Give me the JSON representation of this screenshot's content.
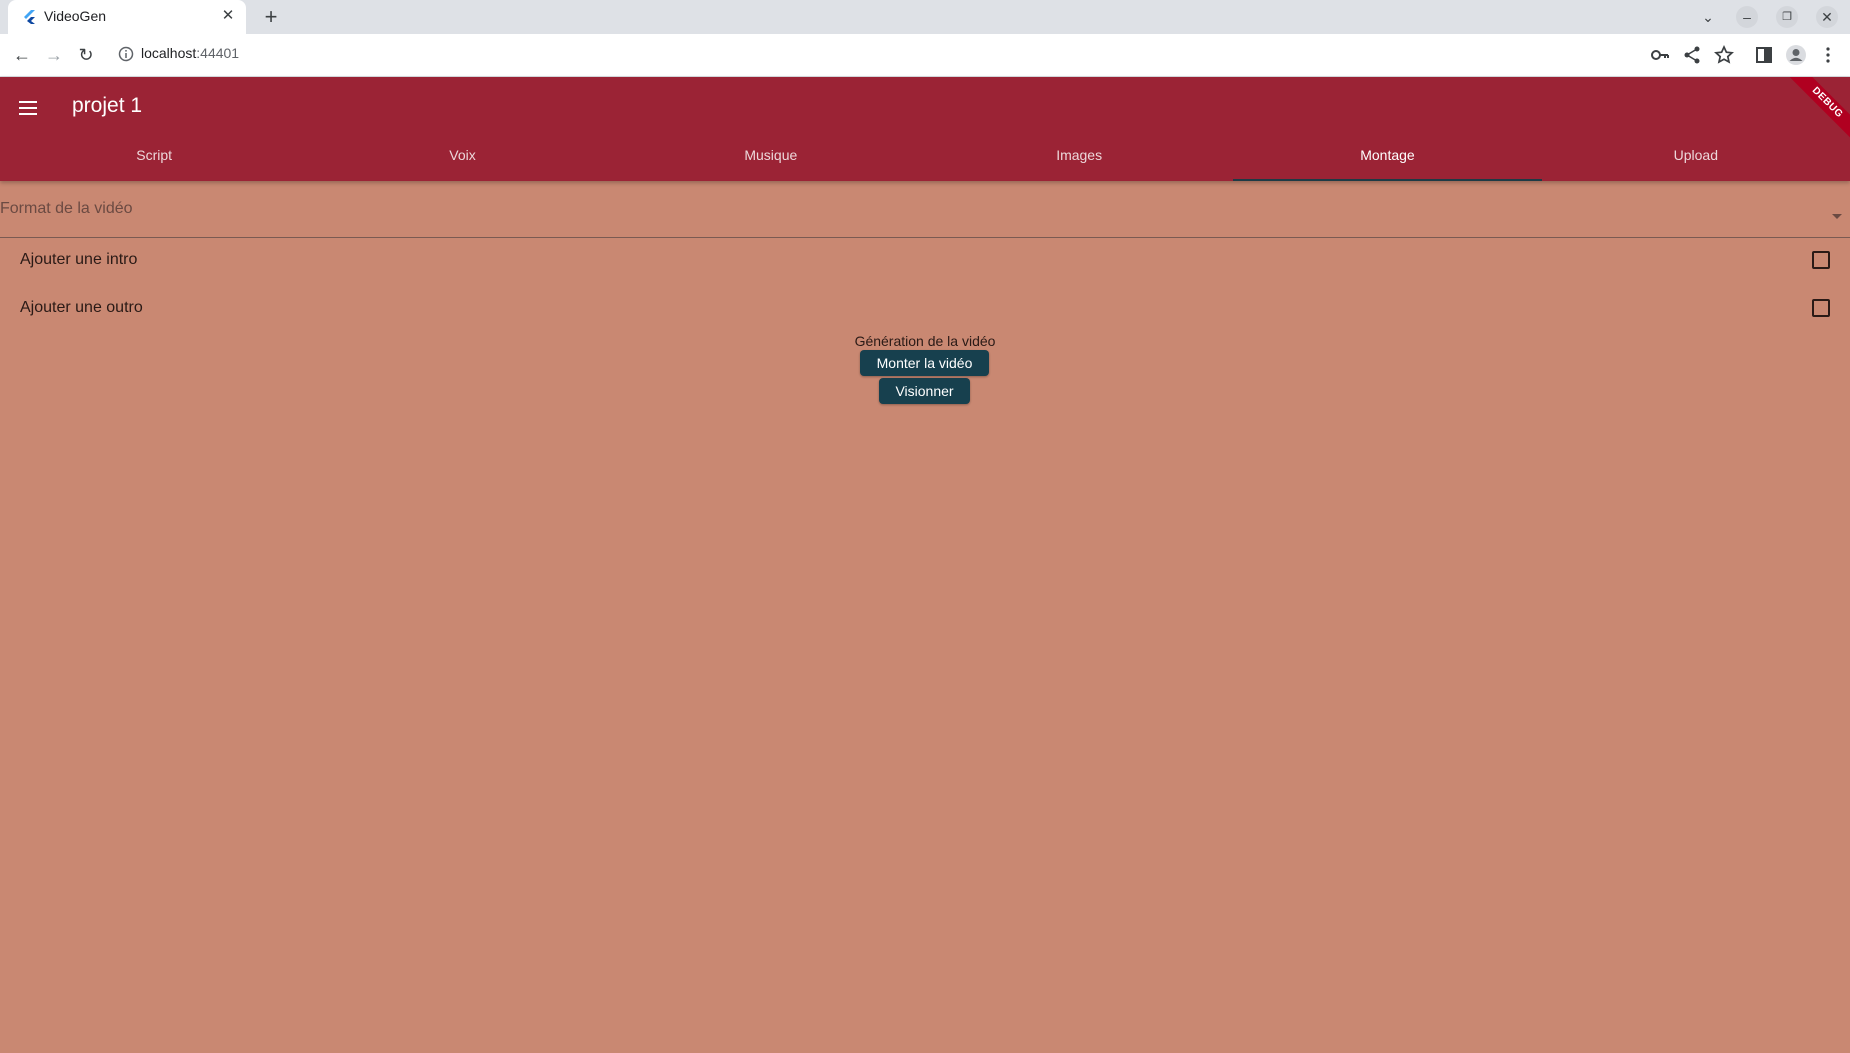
{
  "browser": {
    "tab_title": "VideoGen",
    "url_host": "localhost",
    "url_port": ":44401"
  },
  "app": {
    "title": "projet 1",
    "debug_label": "DEBUG",
    "tabs": [
      "Script",
      "Voix",
      "Musique",
      "Images",
      "Montage",
      "Upload"
    ],
    "active_tab": "Montage"
  },
  "form": {
    "format_label": "Format de la vidéo",
    "intro_label": "Ajouter une intro",
    "intro_checked": false,
    "outro_label": "Ajouter une outro",
    "outro_checked": false
  },
  "generation": {
    "title": "Génération de la vidéo",
    "build_button": "Monter la vidéo",
    "watch_button": "Visionner"
  },
  "colors": {
    "appbar": "#9b2335",
    "background": "#c98872",
    "button": "#17404e"
  }
}
